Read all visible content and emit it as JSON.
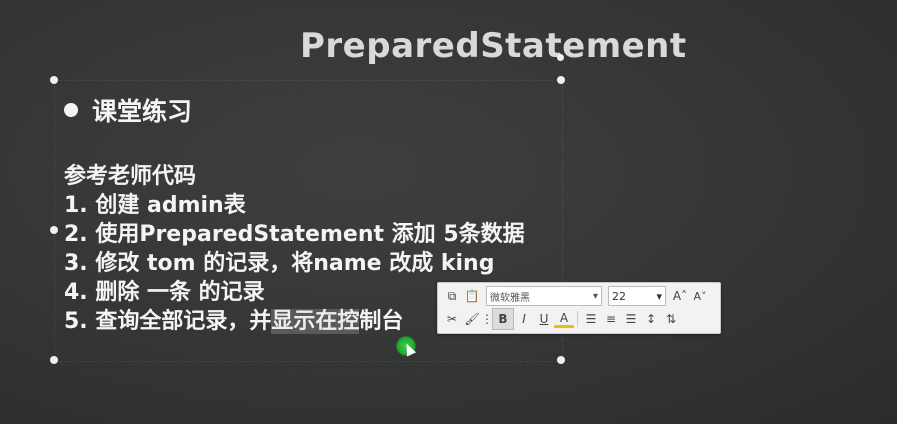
{
  "slide": {
    "title": "PreparedStatement",
    "bullet": "课堂练习",
    "lines": [
      "参考老师代码",
      "1. 创建 admin表",
      "2. 使用PreparedStatement 添加 5条数据",
      "3. 修改 tom 的记录，将name 改成 king",
      "4. 删除 一条 的记录"
    ],
    "line5_prefix": "5. 查询全部记录，并",
    "line5_selected": "显示在控",
    "line5_suffix": "制台"
  },
  "toolbar": {
    "font_name": "微软雅黑",
    "font_size": "22",
    "bold": "B",
    "italic": "I",
    "underline": "U",
    "font_color": "A",
    "grow": "A˄",
    "shrink": "A˅"
  }
}
